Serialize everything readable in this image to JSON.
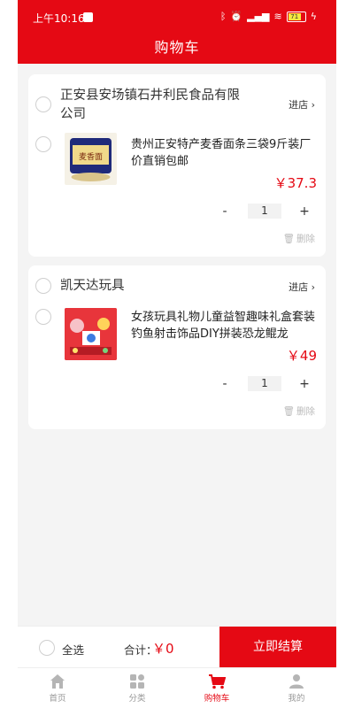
{
  "status": {
    "time": "上午10:16",
    "battery": "71"
  },
  "header": {
    "title": "购物车"
  },
  "shops": [
    {
      "name": "正安县安场镇石井利民食品有限公司",
      "enter_label": "进店",
      "product": {
        "name": "贵州正安特产麦香面条三袋9斤装厂价直销包邮",
        "price": "￥37.3",
        "quantity": "1",
        "thumb_text": "麦香面"
      },
      "minus": "-",
      "plus": "+",
      "delete_label": "删除"
    },
    {
      "name": "凯天达玩具",
      "enter_label": "进店",
      "product": {
        "name": "女孩玩具礼物儿童益智趣味礼盒套装钓鱼射击饰品DIY拼装恐龙鲲龙",
        "price": "￥49",
        "quantity": "1"
      },
      "minus": "-",
      "plus": "+",
      "delete_label": "删除"
    }
  ],
  "footer": {
    "select_all": "全选",
    "total_label": "合计：",
    "total_value": "￥0",
    "checkout": "立即结算"
  },
  "tabs": [
    {
      "label": "首页",
      "icon": "home-icon"
    },
    {
      "label": "分类",
      "icon": "grid-icon"
    },
    {
      "label": "购物车",
      "icon": "cart-icon"
    },
    {
      "label": "我的",
      "icon": "user-icon"
    }
  ],
  "colors": {
    "accent": "#e50914"
  }
}
